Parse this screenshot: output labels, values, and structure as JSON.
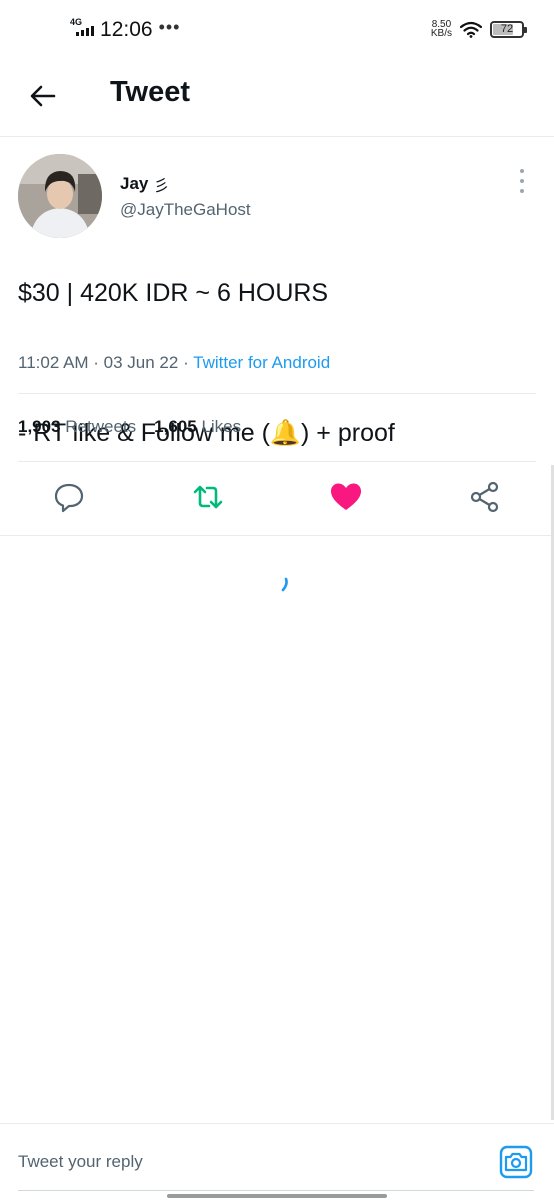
{
  "status_bar": {
    "network": "4G",
    "time": "12:06",
    "more": "•••",
    "speed_value": "8.50",
    "speed_unit": "KB/s",
    "battery_level": "72",
    "signal_icon": "signal-bars-icon",
    "wifi_icon": "wifi-icon"
  },
  "header": {
    "title": "Tweet",
    "back_icon": "arrow-left-icon"
  },
  "tweet": {
    "display_name": "Jay",
    "name_emoji": "彡",
    "handle": "@JayTheGaHost",
    "text_line1": "$30 | 420K IDR ~ 6 HOURS",
    "text_line2": "- RT like & Follow me (🔔) + proof",
    "time": "11:02 AM · 03 Jun 22 · ",
    "source": "Twitter for Android",
    "retweets_count": "1,903",
    "retweets_label": "Retweets",
    "likes_count": "1,605",
    "likes_label": "Likes"
  },
  "actions": {
    "reply_icon": "reply-icon",
    "retweet_icon": "retweet-icon",
    "like_icon": "heart-icon",
    "share_icon": "share-icon"
  },
  "colors": {
    "accent": "#1d9bf0",
    "retweet_green": "#00ba7c",
    "like_pink": "#f91880",
    "muted": "#536471"
  },
  "reply_bar": {
    "placeholder": "Tweet your reply",
    "camera_icon": "camera-icon"
  }
}
